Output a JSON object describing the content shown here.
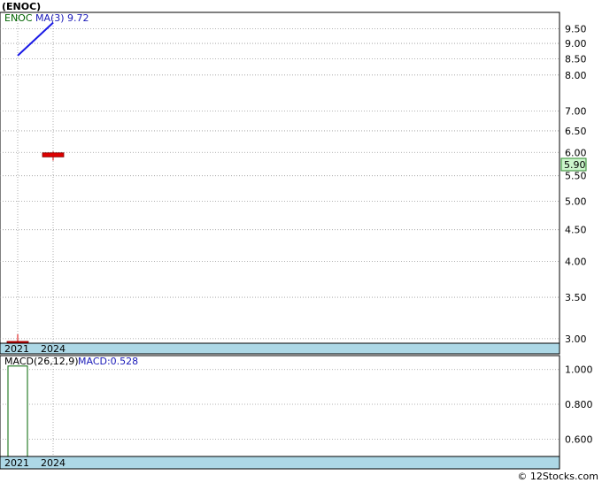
{
  "title": "(ENOC)",
  "footer": "© 12Stocks.com",
  "colors": {
    "background": "#ffffff",
    "candle_red": "#dd0000",
    "ma_line": "#1a1ae6",
    "axis_band": "#add8e6",
    "price_badge": "#ccf5cc",
    "macd_bar_border": "#006400"
  },
  "chart_data": [
    {
      "type": "candlestick",
      "legend": {
        "symbol": "ENOC",
        "ma_label": "MA(3)",
        "ma_value": "9.72"
      },
      "x_ticks": [
        "2021",
        "2024"
      ],
      "y_scale": "log",
      "y_ticks": [
        "9.50",
        "9.00",
        "8.50",
        "8.00",
        "7.00",
        "6.50",
        "6.00",
        "5.50",
        "5.00",
        "4.50",
        "4.00",
        "3.50",
        "3.00"
      ],
      "y_tick_values": [
        9.5,
        9.0,
        8.5,
        8.0,
        7.0,
        6.5,
        6.0,
        5.5,
        5.0,
        4.5,
        4.0,
        3.5,
        3.0
      ],
      "ylim": [
        2.95,
        10.1
      ],
      "candles": [
        {
          "x": "2021",
          "open": 2.97,
          "high": 3.05,
          "low": 2.95,
          "close": 2.95
        },
        {
          "x": "2024",
          "open": 5.99,
          "high": 6.02,
          "low": 5.82,
          "close": 5.9
        }
      ],
      "ma_series": {
        "name": "MA(3)",
        "points": [
          {
            "x": "2021",
            "y": 8.6
          },
          {
            "x": "2024",
            "y": 9.72
          }
        ]
      },
      "last_price": "5.90",
      "grid": true
    },
    {
      "type": "bar",
      "legend": {
        "label": "MACD(26,12,9)",
        "value_label": "MACD:0.528"
      },
      "x_ticks": [
        "2021",
        "2024"
      ],
      "y_ticks": [
        "1.000",
        "0.800",
        "0.600"
      ],
      "y_tick_values": [
        1.0,
        0.8,
        0.6
      ],
      "ylim": [
        0.5,
        1.08
      ],
      "bars": [
        {
          "x": "2021",
          "value": 1.02
        }
      ],
      "grid": true
    }
  ]
}
